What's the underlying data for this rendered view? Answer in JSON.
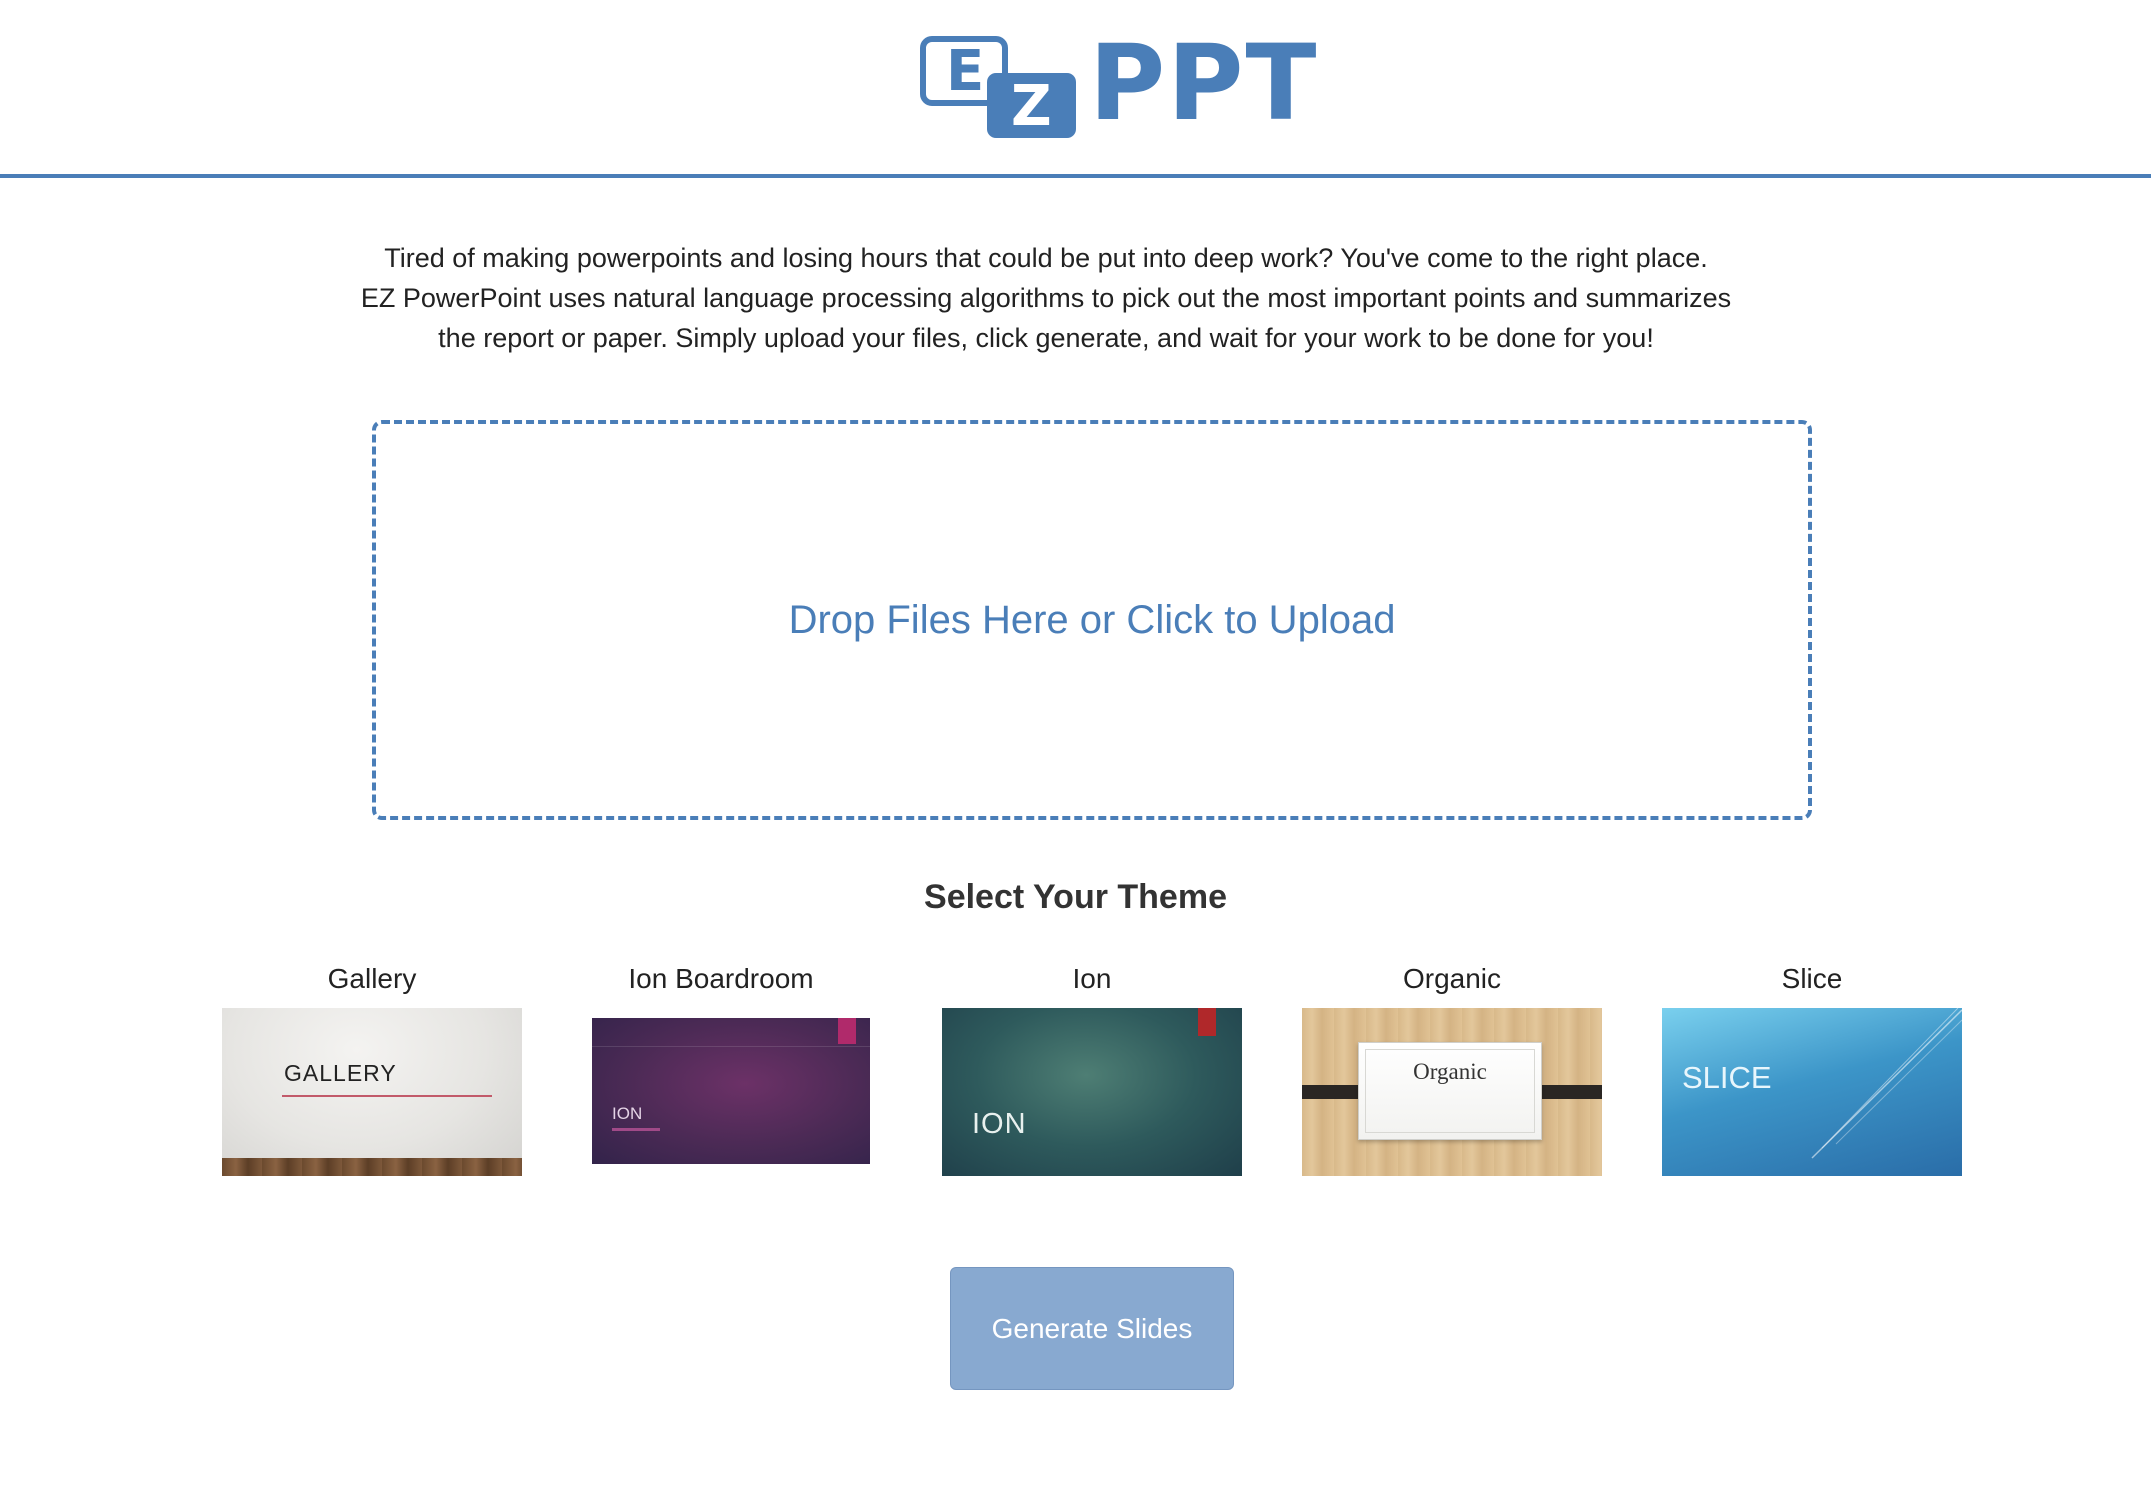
{
  "header": {
    "logo": {
      "letter_e": "E",
      "letter_z": "Z",
      "wordmark": "PPT"
    }
  },
  "intro": {
    "lines": [
      "Tired of making powerpoints and losing hours that could be put into deep work? You've come to the right place.",
      "EZ PowerPoint uses natural language processing algorithms to pick out the most important points and summarizes",
      "the report or paper. Simply upload your files, click generate, and wait for your work to be done for you!"
    ]
  },
  "dropzone": {
    "label": "Drop Files Here or Click to Upload"
  },
  "themes": {
    "heading": "Select Your Theme",
    "items": [
      {
        "label": "Gallery",
        "thumb_title": "GALLERY"
      },
      {
        "label": "Ion Boardroom",
        "thumb_title": "ION"
      },
      {
        "label": "Ion",
        "thumb_title": "ION"
      },
      {
        "label": "Organic",
        "thumb_title": "Organic"
      },
      {
        "label": "Slice",
        "thumb_title": "SLICE"
      }
    ]
  },
  "actions": {
    "generate_label": "Generate Slides"
  },
  "colors": {
    "brand": "#4a7eb8",
    "button": "#88a9d0",
    "text": "#222222"
  }
}
